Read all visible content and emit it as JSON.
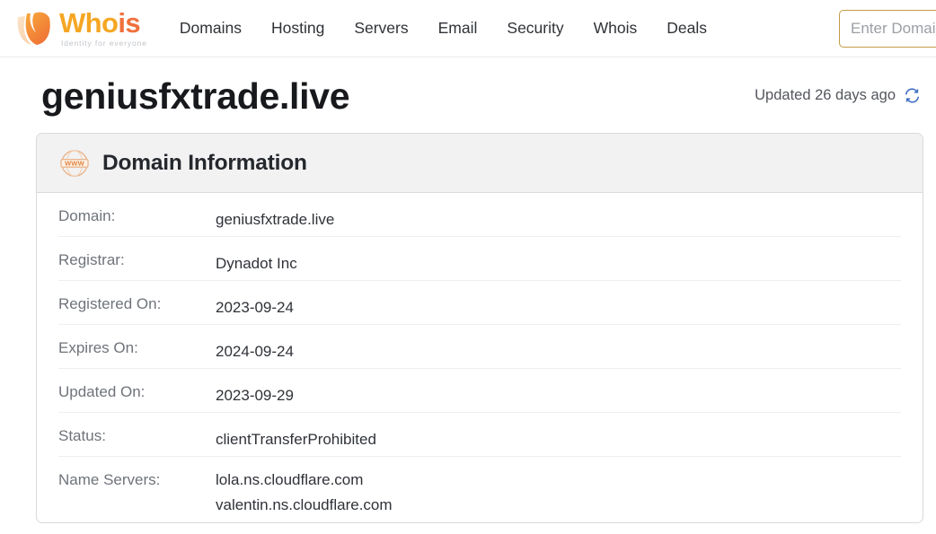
{
  "header": {
    "logo": {
      "mark": "whois-logo-mark",
      "word_part1": "Who",
      "word_part2": "is",
      "tagline": "Identity for everyone"
    },
    "nav": [
      {
        "label": "Domains",
        "name": "nav-item-domains"
      },
      {
        "label": "Hosting",
        "name": "nav-item-hosting"
      },
      {
        "label": "Servers",
        "name": "nav-item-servers"
      },
      {
        "label": "Email",
        "name": "nav-item-email"
      },
      {
        "label": "Security",
        "name": "nav-item-security"
      },
      {
        "label": "Whois",
        "name": "nav-item-whois"
      },
      {
        "label": "Deals",
        "name": "nav-item-deals"
      }
    ],
    "search": {
      "placeholder": "Enter Domain Name",
      "value": ""
    }
  },
  "page": {
    "title": "geniusfxtrade.live",
    "updated_text": "Updated 26 days ago",
    "refresh_icon": "refresh-icon"
  },
  "card": {
    "icon": "www-globe-icon",
    "title": "Domain Information",
    "rows": [
      {
        "label": "Domain:",
        "value": "geniusfxtrade.live"
      },
      {
        "label": "Registrar:",
        "value": "Dynadot Inc"
      },
      {
        "label": "Registered On:",
        "value": "2023-09-24"
      },
      {
        "label": "Expires On:",
        "value": "2024-09-24"
      },
      {
        "label": "Updated On:",
        "value": "2023-09-29"
      },
      {
        "label": "Status:",
        "value": "clientTransferProhibited"
      }
    ],
    "name_servers": {
      "label": "Name Servers:",
      "values": [
        "lola.ns.cloudflare.com",
        "valentin.ns.cloudflare.com"
      ]
    }
  },
  "colors": {
    "brand_yellow": "#f5a623",
    "brand_orange": "#f0703c",
    "refresh_blue": "#3f6fc4",
    "input_border": "#c49b48",
    "card_header_bg": "#f2f2f3",
    "text_dark": "#2f3237",
    "text_muted": "#6f737a"
  }
}
